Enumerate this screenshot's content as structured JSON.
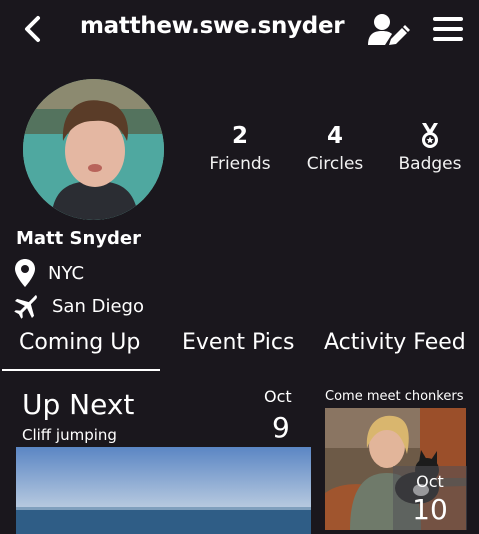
{
  "header": {
    "username": "matthew.swe.snyder"
  },
  "stats": {
    "friends": {
      "value": "2",
      "label": "Friends"
    },
    "circles": {
      "value": "4",
      "label": "Circles"
    },
    "badges": {
      "label": "Badges"
    }
  },
  "profile": {
    "name": "Matt Snyder",
    "home": "NYC",
    "travel": "San Diego"
  },
  "tabs": [
    "Coming Up",
    "Event Pics",
    "Activity Feed"
  ],
  "active_tab": "Coming Up",
  "up_next": {
    "title": "Up Next",
    "subtitle": "Cliff jumping",
    "month": "Oct",
    "day": "9"
  },
  "side_event": {
    "caption": "Come meet chonkers",
    "month": "Oct",
    "day": "10"
  },
  "icons": {
    "back": "chevron-left-icon",
    "edit_profile": "user-edit-icon",
    "menu": "hamburger-menu-icon",
    "badge": "medal-icon",
    "home": "map-pin-icon",
    "travel": "airplane-icon"
  },
  "colors": {
    "background": "#1a171d",
    "text": "#ffffff"
  }
}
